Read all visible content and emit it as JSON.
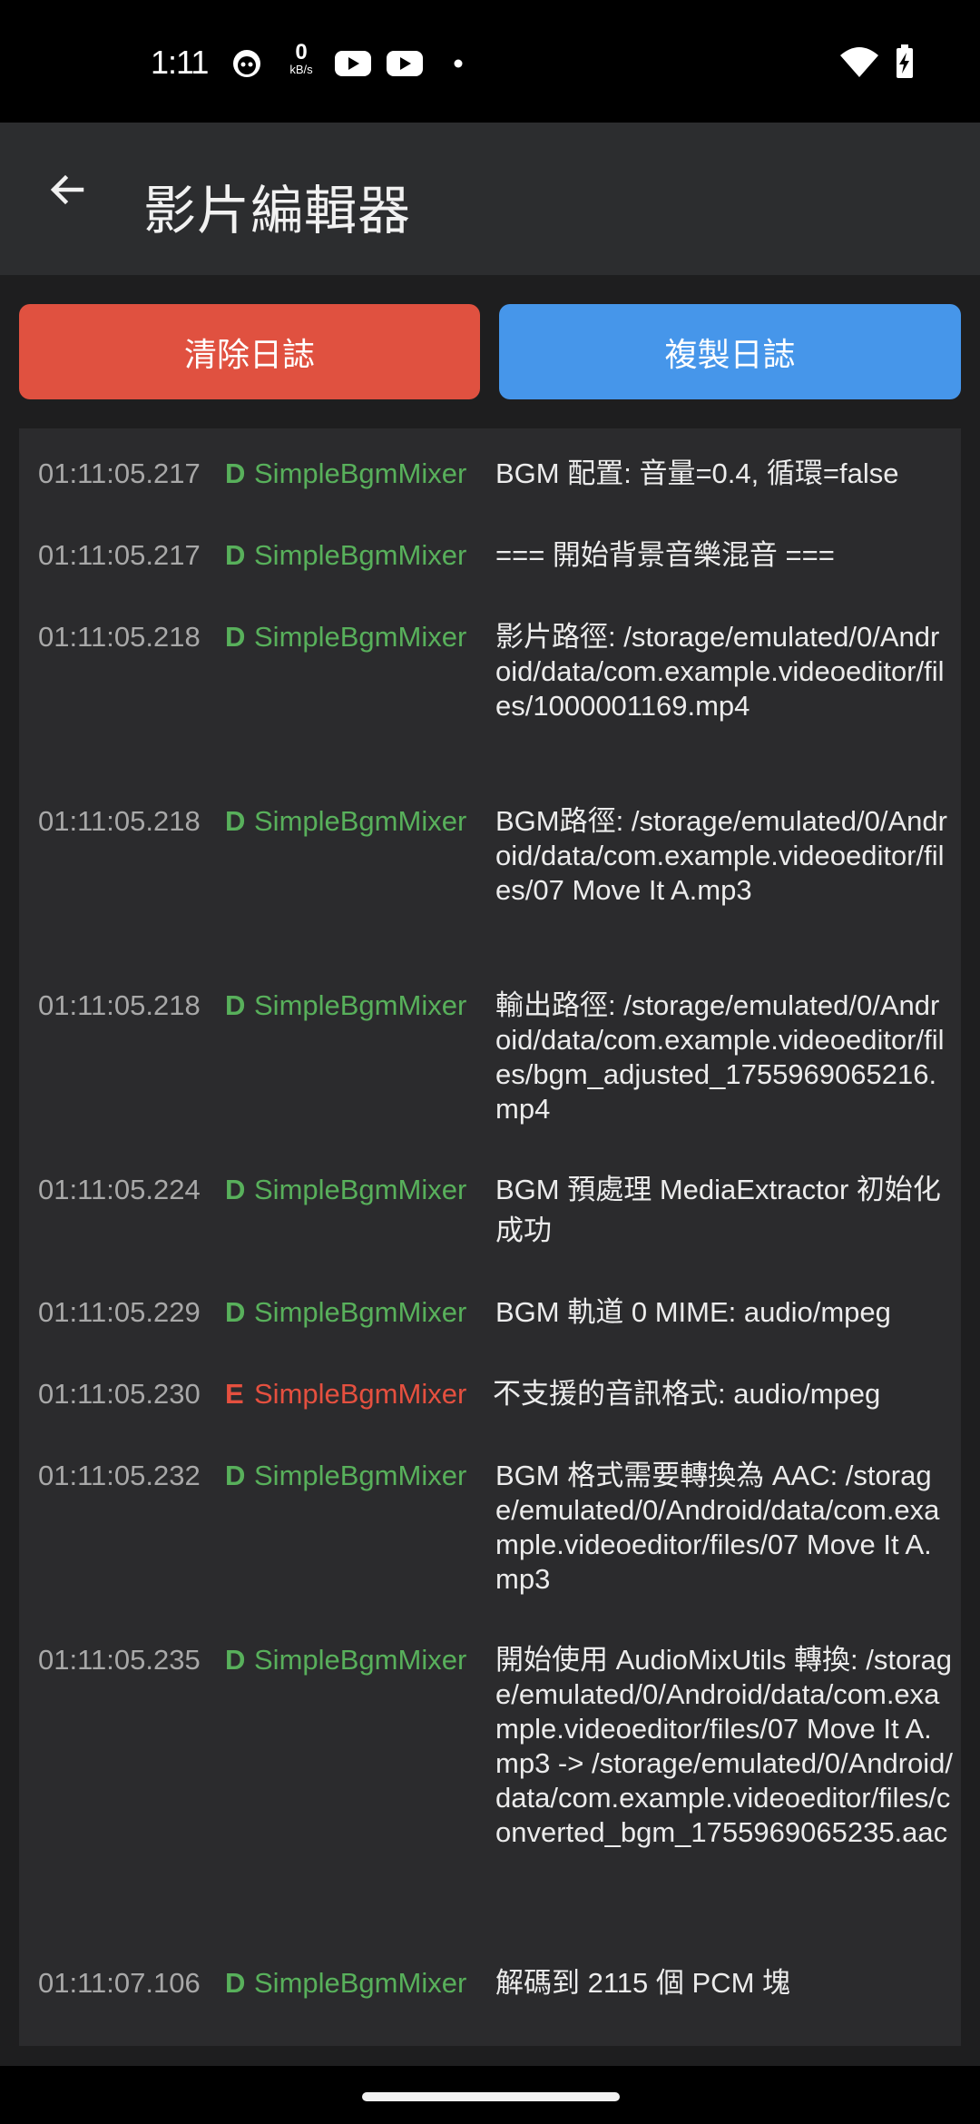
{
  "status_bar": {
    "time": "1:11",
    "speed_value": "0",
    "speed_unit": "kB/s",
    "icons": [
      "cat-face-icon",
      "youtube-icon",
      "youtube-icon",
      "dot-icon",
      "wifi-icon",
      "battery-charging-icon"
    ]
  },
  "app_bar": {
    "back_icon": "arrow-left-icon",
    "title": "影片編輯器"
  },
  "buttons": {
    "clear_label": "清除日誌",
    "copy_label": "複製日誌"
  },
  "colors": {
    "clear_button": "#e05140",
    "copy_button": "#4696ea",
    "debug_level": "#58b05b",
    "error_level": "#e5503f"
  },
  "logs": [
    {
      "time": "01:11:05.217",
      "level": "D",
      "tag": "SimpleBgmMixer",
      "message": "BGM 配置: 音量=0.4, 循環=false"
    },
    {
      "time": "01:11:05.217",
      "level": "D",
      "tag": "SimpleBgmMixer",
      "message": "=== 開始背景音樂混音 ==="
    },
    {
      "time": "01:11:05.218",
      "level": "D",
      "tag": "SimpleBgmMixer",
      "message": "影片路徑: /storage/emulated/0/Android/data/com.example.videoeditor/files/1000001169.mp4"
    },
    {
      "time": "01:11:05.218",
      "level": "D",
      "tag": "SimpleBgmMixer",
      "message": "BGM路徑: /storage/emulated/0/Android/data/com.example.videoeditor/files/07 Move It A.mp3"
    },
    {
      "time": "01:11:05.218",
      "level": "D",
      "tag": "SimpleBgmMixer",
      "message": "輸出路徑: /storage/emulated/0/Android/data/com.example.videoeditor/files/bgm_adjusted_1755969065216.mp4"
    },
    {
      "time": "01:11:05.224",
      "level": "D",
      "tag": "SimpleBgmMixer",
      "message": "BGM 預處理 MediaExtractor 初始化成功"
    },
    {
      "time": "01:11:05.229",
      "level": "D",
      "tag": "SimpleBgmMixer",
      "message": "BGM 軌道 0 MIME: audio/mpeg"
    },
    {
      "time": "01:11:05.230",
      "level": "E",
      "tag": "SimpleBgmMixer",
      "message": "不支援的音訊格式: audio/mpeg"
    },
    {
      "time": "01:11:05.232",
      "level": "D",
      "tag": "SimpleBgmMixer",
      "message": "BGM 格式需要轉換為 AAC: /storage/emulated/0/Android/data/com.example.videoeditor/files/07 Move It A.mp3"
    },
    {
      "time": "01:11:05.235",
      "level": "D",
      "tag": "SimpleBgmMixer",
      "message": "開始使用 AudioMixUtils 轉換: /storage/emulated/0/Android/data/com.example.videoeditor/files/07 Move It A.mp3 -> /storage/emulated/0/Android/data/com.example.videoeditor/files/converted_bgm_1755969065235.aac"
    },
    {
      "time": "01:11:07.106",
      "level": "D",
      "tag": "SimpleBgmMixer",
      "message": "解碼到 2115 個 PCM 塊"
    }
  ]
}
